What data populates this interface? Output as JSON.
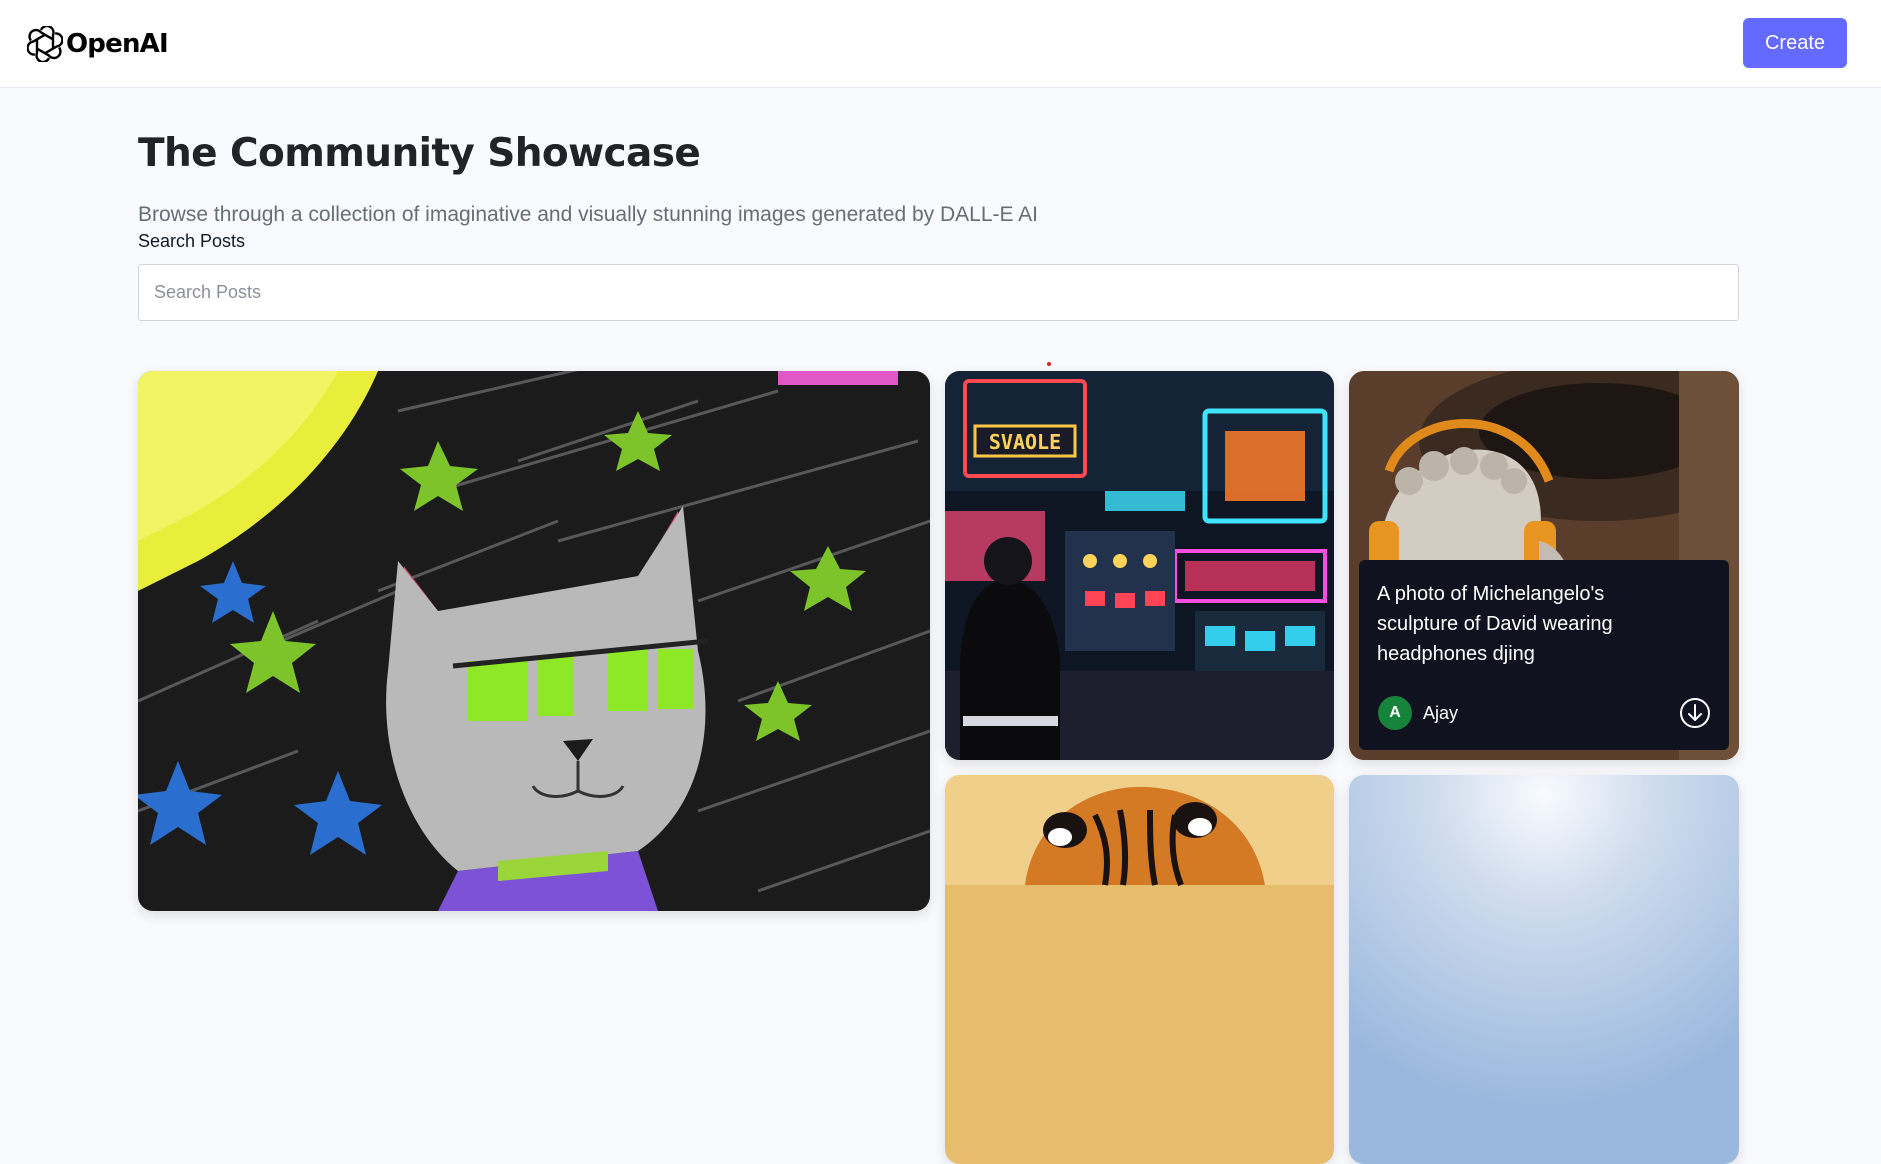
{
  "header": {
    "brand": "OpenAI",
    "logo_icon": "openai-logo-icon",
    "create_label": "Create",
    "accent_color": "#6469ff"
  },
  "main": {
    "title": "The Community Showcase",
    "subtitle": "Browse through a collection of imaginative and visually stunning images generated by DALL-E AI",
    "search": {
      "label": "Search Posts",
      "placeholder": "Search Posts",
      "value": ""
    }
  },
  "cards": [
    {
      "image": "crayon drawing of a grey robot cat under stars and a yellow moon"
    },
    {
      "image": "man walking down a neon-lit night street"
    },
    {
      "image": "Michelangelo's David sculpture wearing orange headphones",
      "prompt": "A photo of Michelangelo's sculpture of David wearing headphones djing",
      "author": "Ajay",
      "avatar_initial": "A",
      "avatar_color": "#16833a",
      "download_icon": "download-icon"
    },
    {
      "image": "close-up of a tiger"
    },
    {
      "image": "bright pale blue sky"
    }
  ]
}
